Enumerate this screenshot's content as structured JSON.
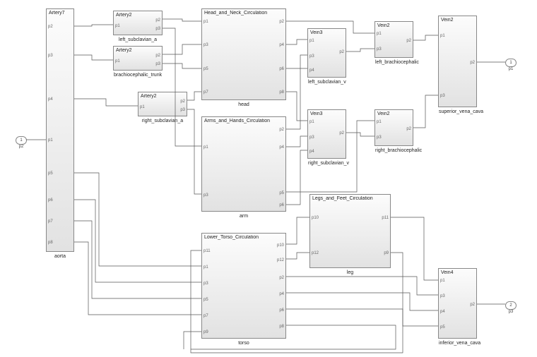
{
  "io": {
    "in1": {
      "num": "1",
      "label": "p2"
    },
    "out1": {
      "num": "1",
      "label": "p1"
    },
    "out2": {
      "num": "2",
      "label": "p3"
    }
  },
  "blocks": {
    "aorta": {
      "title": "Artery7",
      "label": "aorta",
      "ports_left": [
        "",
        "p2",
        "p3",
        "p4",
        "p1",
        "p5",
        "p6",
        "p7",
        "p8"
      ]
    },
    "left_subclavian_a": {
      "title": "Artery2",
      "label": "left_subclavian_a",
      "ports_left": [
        "p1"
      ],
      "ports_right": [
        "p2",
        "p3"
      ]
    },
    "brachiocephalic_trunk": {
      "title": "Artery2",
      "label": "brachiocephalic_trunk",
      "ports_left": [
        "p1"
      ],
      "ports_right": [
        "p2",
        "p3"
      ]
    },
    "right_subclavian_a": {
      "title": "Artery2",
      "label": "right_subclavian_a",
      "ports_left": [
        "p1"
      ],
      "ports_right": [
        "p2",
        "p3"
      ]
    },
    "head": {
      "title": "Head_and_Neck_Circulation",
      "label": "head",
      "ports_left": [
        "p1",
        "p3",
        "p5",
        "p7"
      ],
      "ports_right": [
        "p2",
        "p4",
        "p6",
        "p8"
      ]
    },
    "arm": {
      "title": "Arms_and_Hands_Circulation",
      "label": "arm",
      "ports_left": [
        "p1",
        "p3"
      ],
      "ports_right": [
        "p2",
        "p4",
        "p5",
        "p6"
      ]
    },
    "left_subclavian_v": {
      "title": "Vein3",
      "label": "left_subclavian_v",
      "ports_left": [
        "p1",
        "p3",
        "p4"
      ],
      "ports_right": [
        "p2"
      ]
    },
    "right_subclavian_v": {
      "title": "Vein3",
      "label": "right_subclavian_v",
      "ports_left": [
        "p1",
        "p3",
        "p4"
      ],
      "ports_right": [
        "p2"
      ]
    },
    "left_brachiocephalic": {
      "title": "Vein2",
      "label": "left_brachiocephalic",
      "ports_left": [
        "p1",
        "p3"
      ],
      "ports_right": [
        "p2"
      ]
    },
    "right_brachiocephalic": {
      "title": "Vein2",
      "label": "right_brachiocephalic",
      "ports_left": [
        "p1",
        "p3"
      ],
      "ports_right": [
        "p2"
      ]
    },
    "superior_vena_cava": {
      "title": "Vein2",
      "label": "superior_vena_cava",
      "ports_left": [
        "p1",
        "p3"
      ],
      "ports_right": [
        "p2"
      ]
    },
    "torso": {
      "title": "Lower_Torso_Circulation",
      "label": "torso",
      "ports_left": [
        "p11",
        "p1",
        "p3",
        "p5",
        "p7",
        "p9"
      ],
      "ports_right": [
        "p10",
        "p12",
        "p2",
        "p4",
        "p6",
        "p8"
      ]
    },
    "leg": {
      "title": "Legs_and_Feet_Circulation",
      "label": "leg",
      "ports_left": [
        "p10",
        "p12"
      ],
      "ports_right": [
        "p11",
        "p9"
      ]
    },
    "inferior_vena_cava": {
      "title": "Vein4",
      "label": "inferior_vena_cava",
      "ports_left": [
        "p1",
        "p3",
        "p4",
        "p5"
      ],
      "ports_right": [
        "p2"
      ]
    }
  }
}
